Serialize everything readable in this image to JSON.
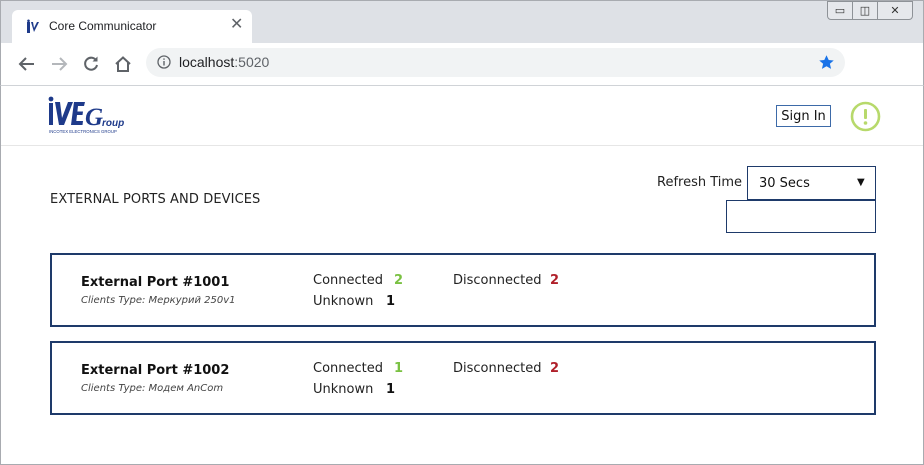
{
  "browser": {
    "tab_title": "Core Communicator",
    "close_glyph": "✕",
    "url_host": "localhost",
    "url_port": ":5020",
    "window_controls": {
      "minimize": "▭",
      "maximize": "◫",
      "close": "✕"
    }
  },
  "header": {
    "sign_in_label": "Sign In",
    "logo_text": "IVEGroup",
    "logo_subtitle": "INCOTEX ELECTRONICS GROUP",
    "alert_color": "#b7d96b"
  },
  "main": {
    "section_title": "EXTERNAL PORTS AND DEVICES",
    "refresh_label": "Refresh Time",
    "refresh_value": "30 Secs",
    "caret": "▼",
    "connected_label": "Connected",
    "disconnected_label": "Disconnected",
    "unknown_label": "Unknown",
    "ports": [
      {
        "name": "External Port #1001",
        "type": "Clients Type: Меркурий 250v1",
        "connected": "2",
        "disconnected": "2",
        "unknown": "1"
      },
      {
        "name": "External Port #1002",
        "type": "Clients Type: Модем AnCom",
        "connected": "1",
        "disconnected": "2",
        "unknown": "1"
      }
    ]
  },
  "colors": {
    "connected": "#7ac142",
    "disconnected": "#b0202a",
    "unknown": "#111111",
    "border": "#1e3a6a"
  }
}
